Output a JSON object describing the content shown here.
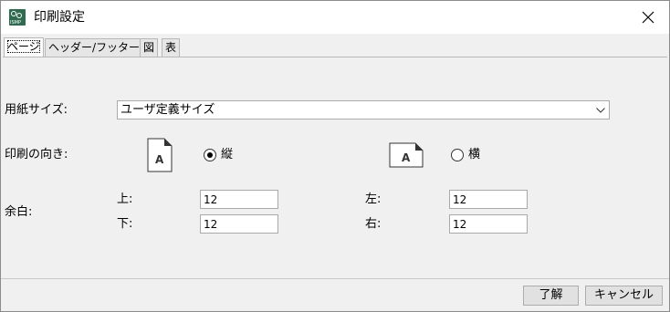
{
  "window": {
    "title": "印刷設定",
    "app_icon_label": "ISMP"
  },
  "tabs": [
    {
      "label": "ページ",
      "active": true
    },
    {
      "label": "ヘッダー/フッター",
      "active": false
    },
    {
      "label": "図",
      "active": false
    },
    {
      "label": "表",
      "active": false
    }
  ],
  "paper_size": {
    "label": "用紙サイズ:",
    "value": "ユーザ定義サイズ"
  },
  "orientation": {
    "label": "印刷の向き:",
    "portrait_label": "縦",
    "landscape_label": "横",
    "selected": "portrait"
  },
  "margins": {
    "label": "余白:",
    "top": {
      "label": "上:",
      "value": "12"
    },
    "bottom": {
      "label": "下:",
      "value": "12"
    },
    "left": {
      "label": "左:",
      "value": "12"
    },
    "right": {
      "label": "右:",
      "value": "12"
    }
  },
  "buttons": {
    "ok": "了解",
    "cancel": "キャンセル"
  },
  "colors": {
    "app_icon": "#2e6b4f",
    "background": "#f0f0f0"
  }
}
